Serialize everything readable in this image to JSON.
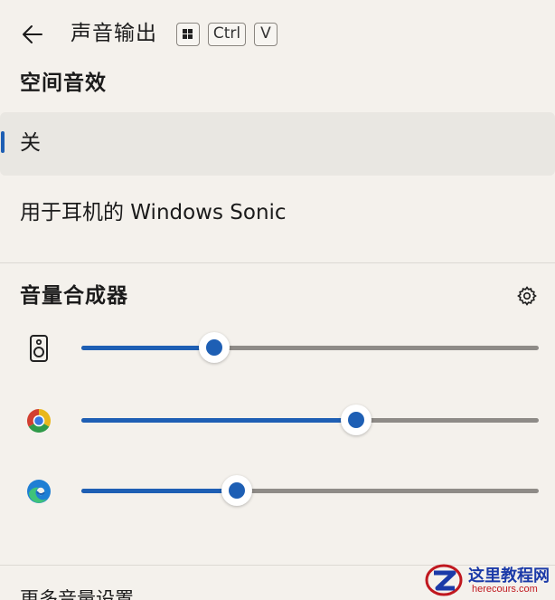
{
  "header": {
    "title": "声音输出",
    "shortcut_keys": [
      "Ctrl",
      "V"
    ],
    "icons": {
      "back": "back-arrow-icon",
      "windows_key": "windows-key-icon"
    }
  },
  "spatial_sound": {
    "title": "空间音效",
    "options": [
      {
        "label": "关",
        "selected": true
      },
      {
        "label": "用于耳机的 Windows Sonic",
        "selected": false
      }
    ]
  },
  "mixer": {
    "title": "音量合成器",
    "settings_icon": "gear-icon",
    "apps": [
      {
        "icon": "speaker-icon",
        "volume_fraction": 0.29
      },
      {
        "icon": "chrome-icon",
        "volume_fraction": 0.6
      },
      {
        "icon": "edge-icon",
        "volume_fraction": 0.34
      }
    ]
  },
  "more_link": "更多音量设置",
  "watermark": {
    "name": "这里教程网",
    "domain": "herecours.com"
  },
  "colors": {
    "accent": "#1e5fb4",
    "background": "#f4f1ec",
    "selected_row": "#e9e7e2",
    "track": "#8e8b87"
  }
}
